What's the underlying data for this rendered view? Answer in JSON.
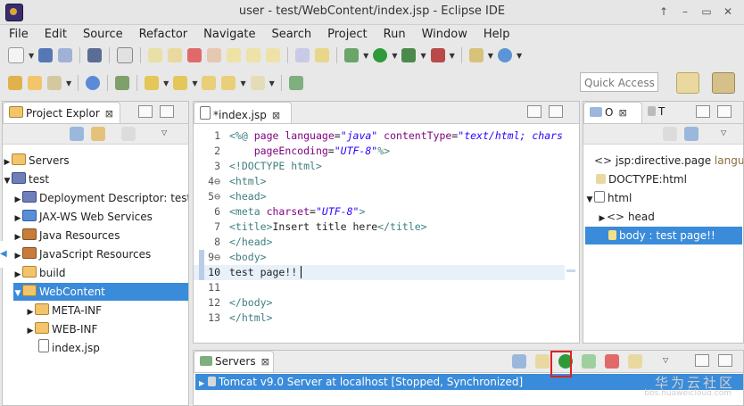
{
  "window": {
    "title": "user - test/WebContent/index.jsp - Eclipse IDE"
  },
  "menu": [
    "File",
    "Edit",
    "Source",
    "Refactor",
    "Navigate",
    "Search",
    "Project",
    "Run",
    "Window",
    "Help"
  ],
  "toolbar": {
    "quick_access_placeholder": "Quick Access"
  },
  "project_explorer": {
    "tab_label": "Project Explor",
    "items": [
      {
        "label": "Servers"
      },
      {
        "label": "test"
      },
      {
        "label": "Deployment Descriptor: test"
      },
      {
        "label": "JAX-WS Web Services"
      },
      {
        "label": "Java Resources"
      },
      {
        "label": "JavaScript Resources"
      },
      {
        "label": "build"
      },
      {
        "label": "WebContent"
      },
      {
        "label": "META-INF"
      },
      {
        "label": "WEB-INF"
      },
      {
        "label": "index.jsp"
      }
    ]
  },
  "editor": {
    "tab_label": "*index.jsp",
    "lines": [
      {
        "n": "1",
        "fold": false
      },
      {
        "n": "2",
        "fold": false
      },
      {
        "n": "3",
        "fold": false
      },
      {
        "n": "4",
        "fold": true
      },
      {
        "n": "5",
        "fold": true
      },
      {
        "n": "6",
        "fold": false
      },
      {
        "n": "7",
        "fold": false
      },
      {
        "n": "8",
        "fold": false
      },
      {
        "n": "9",
        "fold": true
      },
      {
        "n": "10",
        "fold": false
      },
      {
        "n": "11",
        "fold": false
      },
      {
        "n": "12",
        "fold": false
      },
      {
        "n": "13",
        "fold": false
      }
    ],
    "code": {
      "l1": "<%@ page language=\"java\" contentType=\"text/html; chars",
      "l2": "    pageEncoding=\"UTF-8\"%>",
      "l3": "<!DOCTYPE html>",
      "l4": "<html>",
      "l5": "<head>",
      "l6": "<meta charset=\"UTF-8\">",
      "l7": "<title>Insert title here</title>",
      "l8": "</head>",
      "l9": "<body>",
      "l10": "test page!!",
      "l11": "",
      "l12": "</body>",
      "l13": "</html>"
    }
  },
  "outline": {
    "tab_o": "O",
    "tab_t": "T",
    "items": [
      {
        "label": "jsp:directive.page",
        "extra": "languag"
      },
      {
        "label": "DOCTYPE:html"
      },
      {
        "label": "html"
      },
      {
        "label": "head"
      },
      {
        "label": "body : test page!!"
      }
    ]
  },
  "servers": {
    "tab_label": "Servers",
    "row": "Tomcat v9.0 Server at localhost  [Stopped, Synchronized]"
  },
  "watermark": {
    "line1": "华为云社区",
    "line2": "bbs.huaweicloud.com"
  },
  "colors": {
    "selection": "#3a8bd9",
    "highlight_box": "#e02020",
    "run_green": "#2e9a3a"
  }
}
